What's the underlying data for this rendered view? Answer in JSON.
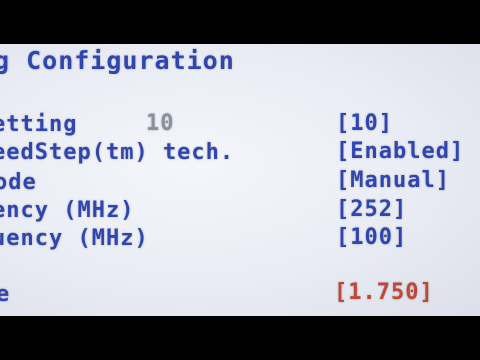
{
  "title": "g Configuration",
  "rows": [
    {
      "label": "etting",
      "default": "10",
      "value": "[10]"
    },
    {
      "label": "eedStep(tm) tech.",
      "value": "[Enabled]"
    },
    {
      "label": "ode",
      "value": "[Manual]"
    },
    {
      "label": "ency (MHz)",
      "value": "[252]"
    },
    {
      "label": "uency (MHz)",
      "value": "[100]"
    },
    {
      "label": "e",
      "value": "[1.750]"
    }
  ],
  "colors": {
    "label": "#2f45b0",
    "value": "#2f45b0",
    "default": "#8a8f9c",
    "highlight_value": "#c0473a",
    "background": "#eceef5"
  }
}
